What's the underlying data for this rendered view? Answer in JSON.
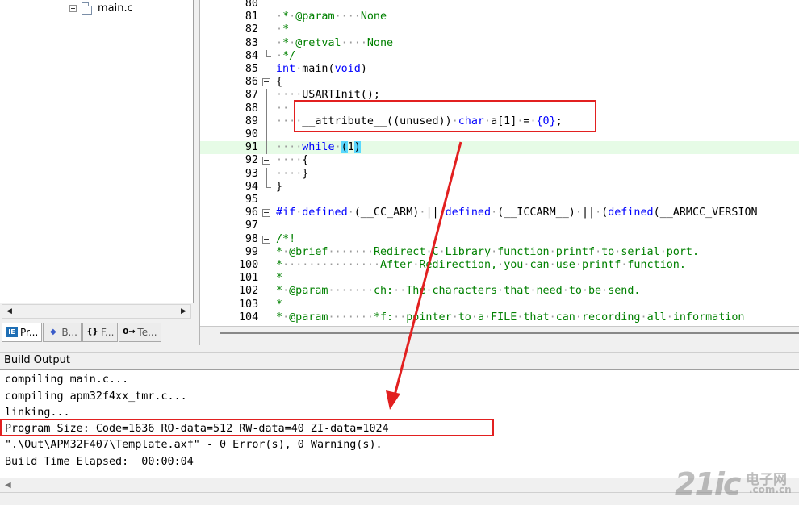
{
  "project": {
    "tree_item": "main.c",
    "tabs": [
      {
        "icon": "IE",
        "label": "Pr..."
      },
      {
        "icon": "◆",
        "label": "B..."
      },
      {
        "icon": "{}",
        "label": "F..."
      },
      {
        "icon": "0→",
        "label": "Te..."
      }
    ]
  },
  "editor": {
    "lines": [
      {
        "n": "80",
        "t": ""
      },
      {
        "n": "81",
        "t": "·*·@param····None"
      },
      {
        "n": "82",
        "t": "·*"
      },
      {
        "n": "83",
        "t": "·*·@retval····None"
      },
      {
        "n": "84",
        "t": "·*/"
      },
      {
        "n": "85",
        "t": "int·main(void)"
      },
      {
        "n": "86",
        "t": "{"
      },
      {
        "n": "87",
        "t": "····USARTInit();"
      },
      {
        "n": "88",
        "t": "··"
      },
      {
        "n": "89",
        "t": "····__attribute__((unused))·char·a[1]·=·{0};"
      },
      {
        "n": "90",
        "t": ""
      },
      {
        "n": "91",
        "t": "····while·(1)"
      },
      {
        "n": "92",
        "t": "····{"
      },
      {
        "n": "93",
        "t": "····}"
      },
      {
        "n": "94",
        "t": "}"
      },
      {
        "n": "95",
        "t": ""
      },
      {
        "n": "96",
        "t": "#if·defined·(__CC_ARM)·||·defined·(__ICCARM__)·||·(defined(__ARMCC_VERSION"
      },
      {
        "n": "97",
        "t": ""
      },
      {
        "n": "98",
        "t": "/*!"
      },
      {
        "n": "99",
        "t": "*·@brief·······Redirect·C·Library·function·printf·to·serial·port."
      },
      {
        "n": "100",
        "t": "*···············After·Redirection,·you·can·use·printf·function."
      },
      {
        "n": "101",
        "t": "*"
      },
      {
        "n": "102",
        "t": "*·@param·······ch:··The·characters·that·need·to·be·send."
      },
      {
        "n": "103",
        "t": "*"
      },
      {
        "n": "104",
        "t": "*·@param·······*f:··pointer·to·a·FILE·that·can·recording·all·information"
      }
    ]
  },
  "build": {
    "title": "Build Output",
    "lines": [
      "compiling main.c...",
      "compiling apm32f4xx_tmr.c...",
      "linking...",
      "Program Size: Code=1636 RO-data=512 RW-data=40 ZI-data=1024",
      "\".\\Out\\APM32F407\\Template.axf\" - 0 Error(s), 0 Warning(s).",
      "Build Time Elapsed:  00:00:04"
    ]
  },
  "watermark": {
    "brand": "21ic",
    "cn": "电子网",
    "domain": ".com.cn"
  },
  "colors": {
    "comment": "#008000",
    "keyword": "#0000ff",
    "highlight": "#e6fbe6",
    "annotation": "#e22020"
  }
}
